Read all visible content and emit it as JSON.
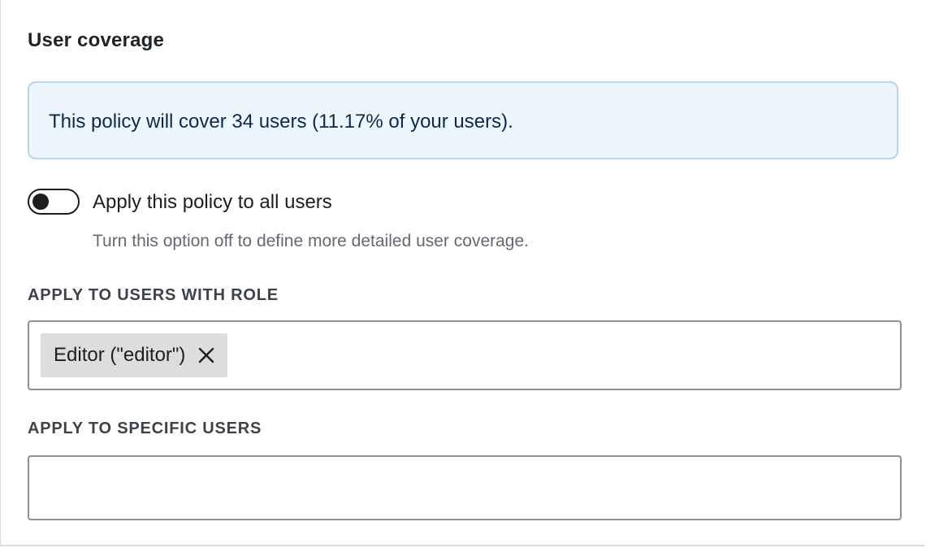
{
  "section": {
    "title": "User coverage"
  },
  "notice": {
    "text": "This policy will cover 34 users (11.17% of your users)."
  },
  "toggle": {
    "label": "Apply this policy to all users",
    "help": "Turn this option off to define more detailed user coverage.",
    "checked": false
  },
  "role_field": {
    "label": "APPLY TO USERS WITH ROLE",
    "tokens": [
      {
        "label": "Editor (\"editor\")"
      }
    ],
    "remove_icon": "close-icon"
  },
  "users_field": {
    "label": "APPLY TO SPECIFIC USERS",
    "value": "",
    "placeholder": ""
  },
  "colors": {
    "notice_bg": "#eef6fd",
    "notice_border": "#b6d3ea",
    "token_bg": "#dddddd",
    "toggle": "#1e1e1e"
  }
}
